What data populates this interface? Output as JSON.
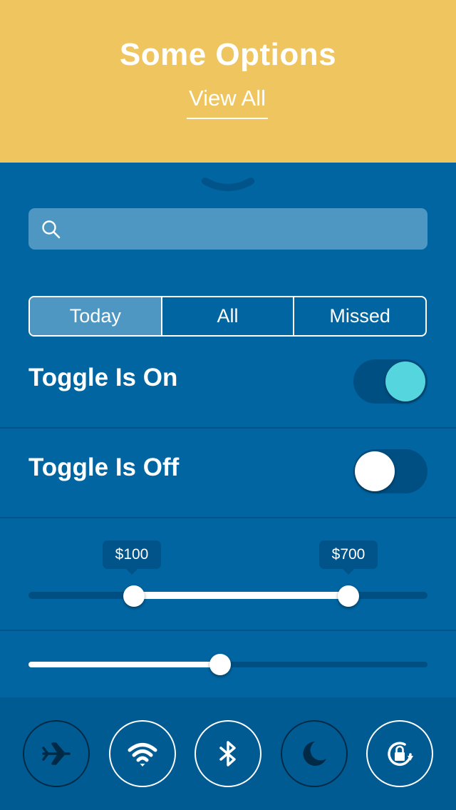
{
  "header": {
    "title": "Some Options",
    "link": "View All"
  },
  "search": {
    "placeholder": ""
  },
  "segments": [
    {
      "label": "Today",
      "active": true
    },
    {
      "label": "All",
      "active": false
    },
    {
      "label": "Missed",
      "active": false
    }
  ],
  "toggles": [
    {
      "label": "Toggle Is On",
      "on": true
    },
    {
      "label": "Toggle Is Off",
      "on": false
    }
  ],
  "range_slider": {
    "min_label": "$100",
    "max_label": "$700"
  },
  "single_slider": {
    "value_fraction": 0.48
  },
  "quick_settings": [
    {
      "icon": "airplane-icon",
      "active": false
    },
    {
      "icon": "wifi-icon",
      "active": true
    },
    {
      "icon": "bluetooth-icon",
      "active": true
    },
    {
      "icon": "moon-icon",
      "active": false
    },
    {
      "icon": "rotation-lock-icon",
      "active": true
    }
  ],
  "colors": {
    "header": "#efc55f",
    "panel": "#0065a1",
    "accent": "#55d6df",
    "segment_active": "#4e97c2"
  }
}
